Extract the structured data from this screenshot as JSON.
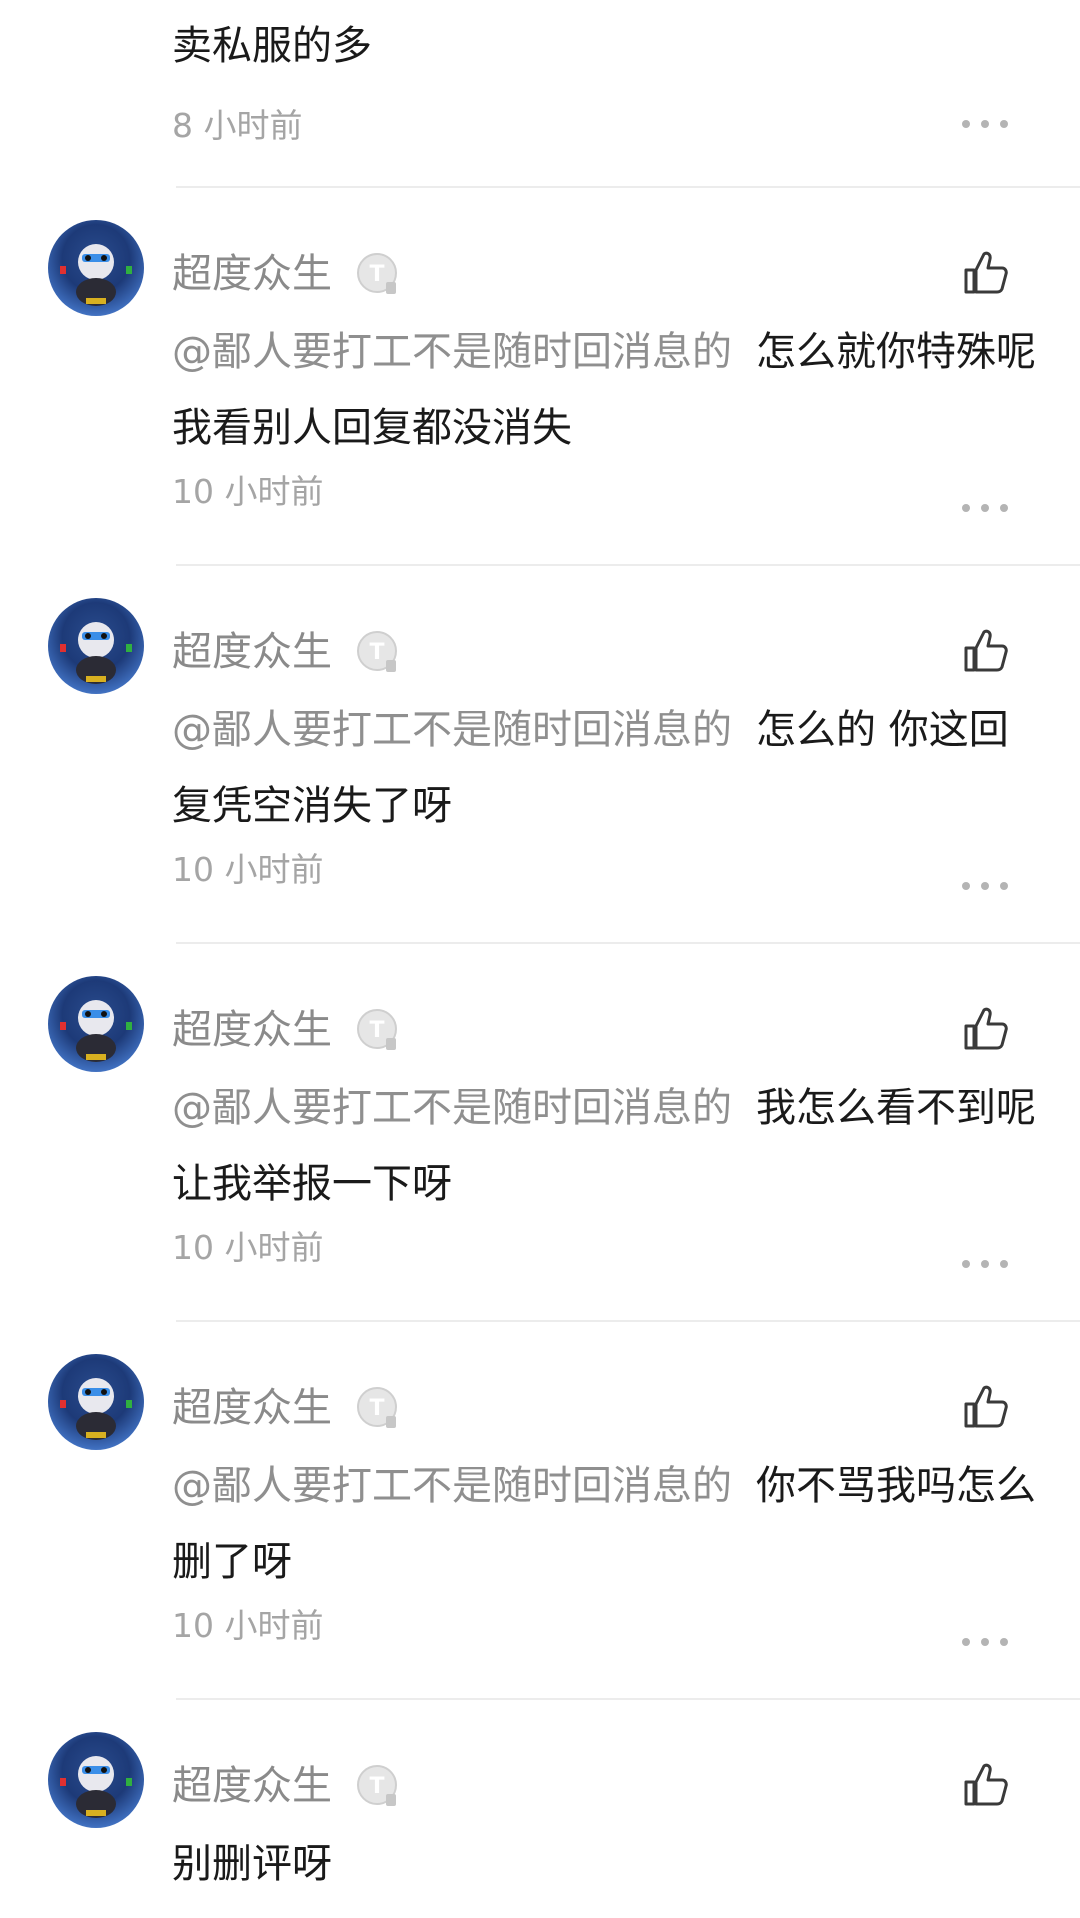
{
  "top_comment": {
    "text": "卖私服的多",
    "time": "8 小时前"
  },
  "comments": [
    {
      "username": "超度众生",
      "mention": "@鄙人要打工不是随时回消息的",
      "text": "怎么就你特殊呢 我看别人回复都没消失",
      "time": "10 小时前"
    },
    {
      "username": "超度众生",
      "mention": "@鄙人要打工不是随时回消息的",
      "text": "怎么的 你这回复凭空消失了呀",
      "time": "10 小时前"
    },
    {
      "username": "超度众生",
      "mention": "@鄙人要打工不是随时回消息的",
      "text": "我怎么看不到呢让我举报一下呀",
      "time": "10 小时前"
    },
    {
      "username": "超度众生",
      "mention": "@鄙人要打工不是随时回消息的",
      "text": "你不骂我吗怎么删了呀",
      "time": "10 小时前"
    },
    {
      "username": "超度众生",
      "mention": "",
      "text": "别删评呀",
      "time": ""
    }
  ],
  "icons": {
    "more": "more-dots-icon",
    "like": "thumbs-up-icon",
    "badge": "level-badge-icon"
  },
  "colors": {
    "name": "#8a8a8a",
    "mention": "#8f8f8f",
    "text": "#1a1a1a",
    "time": "#a5a5a5",
    "divider": "#ececec"
  }
}
